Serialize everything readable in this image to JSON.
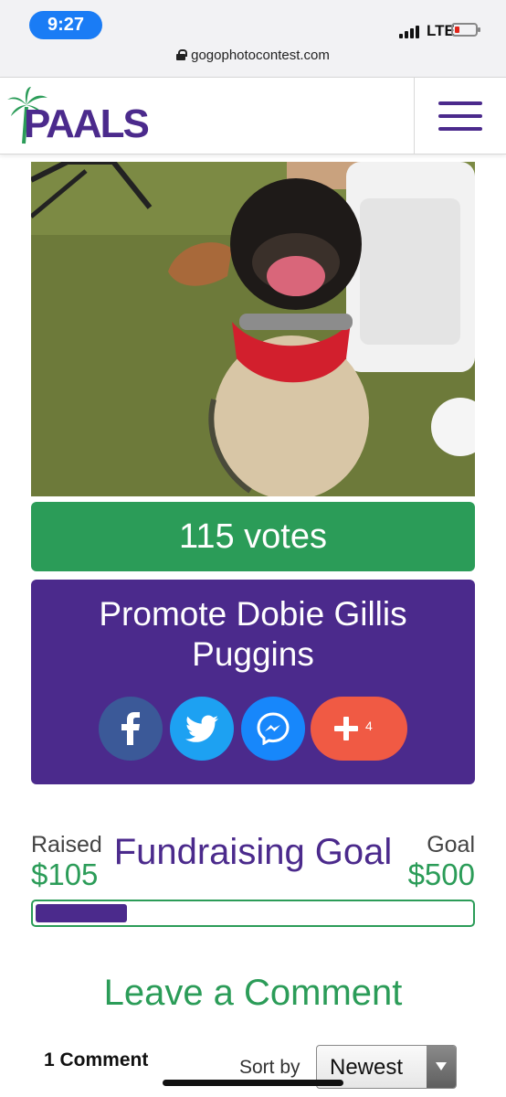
{
  "status_bar": {
    "time": "9:27",
    "network": "LTE",
    "url": "gogophotocontest.com"
  },
  "header": {
    "logo_text": "PAALS"
  },
  "entry": {
    "votes": "115 votes",
    "promote_title": "Promote Dobie Gillis Puggins"
  },
  "share": {
    "more_count": "4"
  },
  "fundraising": {
    "title": "Fundraising Goal",
    "raised_label": "Raised",
    "raised_value": "$105",
    "goal_label": "Goal",
    "goal_value": "$500",
    "progress_fraction": 0.21
  },
  "comments": {
    "title": "Leave a Comment",
    "count": "1 Comment",
    "sort_label": "Sort by",
    "sort_value": "Newest"
  },
  "colors": {
    "brand_purple": "#4b2a8c",
    "brand_green": "#2b9c58",
    "share_facebook": "#3b5998",
    "share_twitter": "#1da1f2",
    "share_messenger": "#1787fb",
    "share_more": "#f05a44"
  },
  "icons": [
    "lock-icon",
    "menu-icon",
    "palm-tree-icon",
    "facebook-icon",
    "twitter-icon",
    "messenger-icon",
    "plus-icon",
    "chevron-down-icon"
  ]
}
